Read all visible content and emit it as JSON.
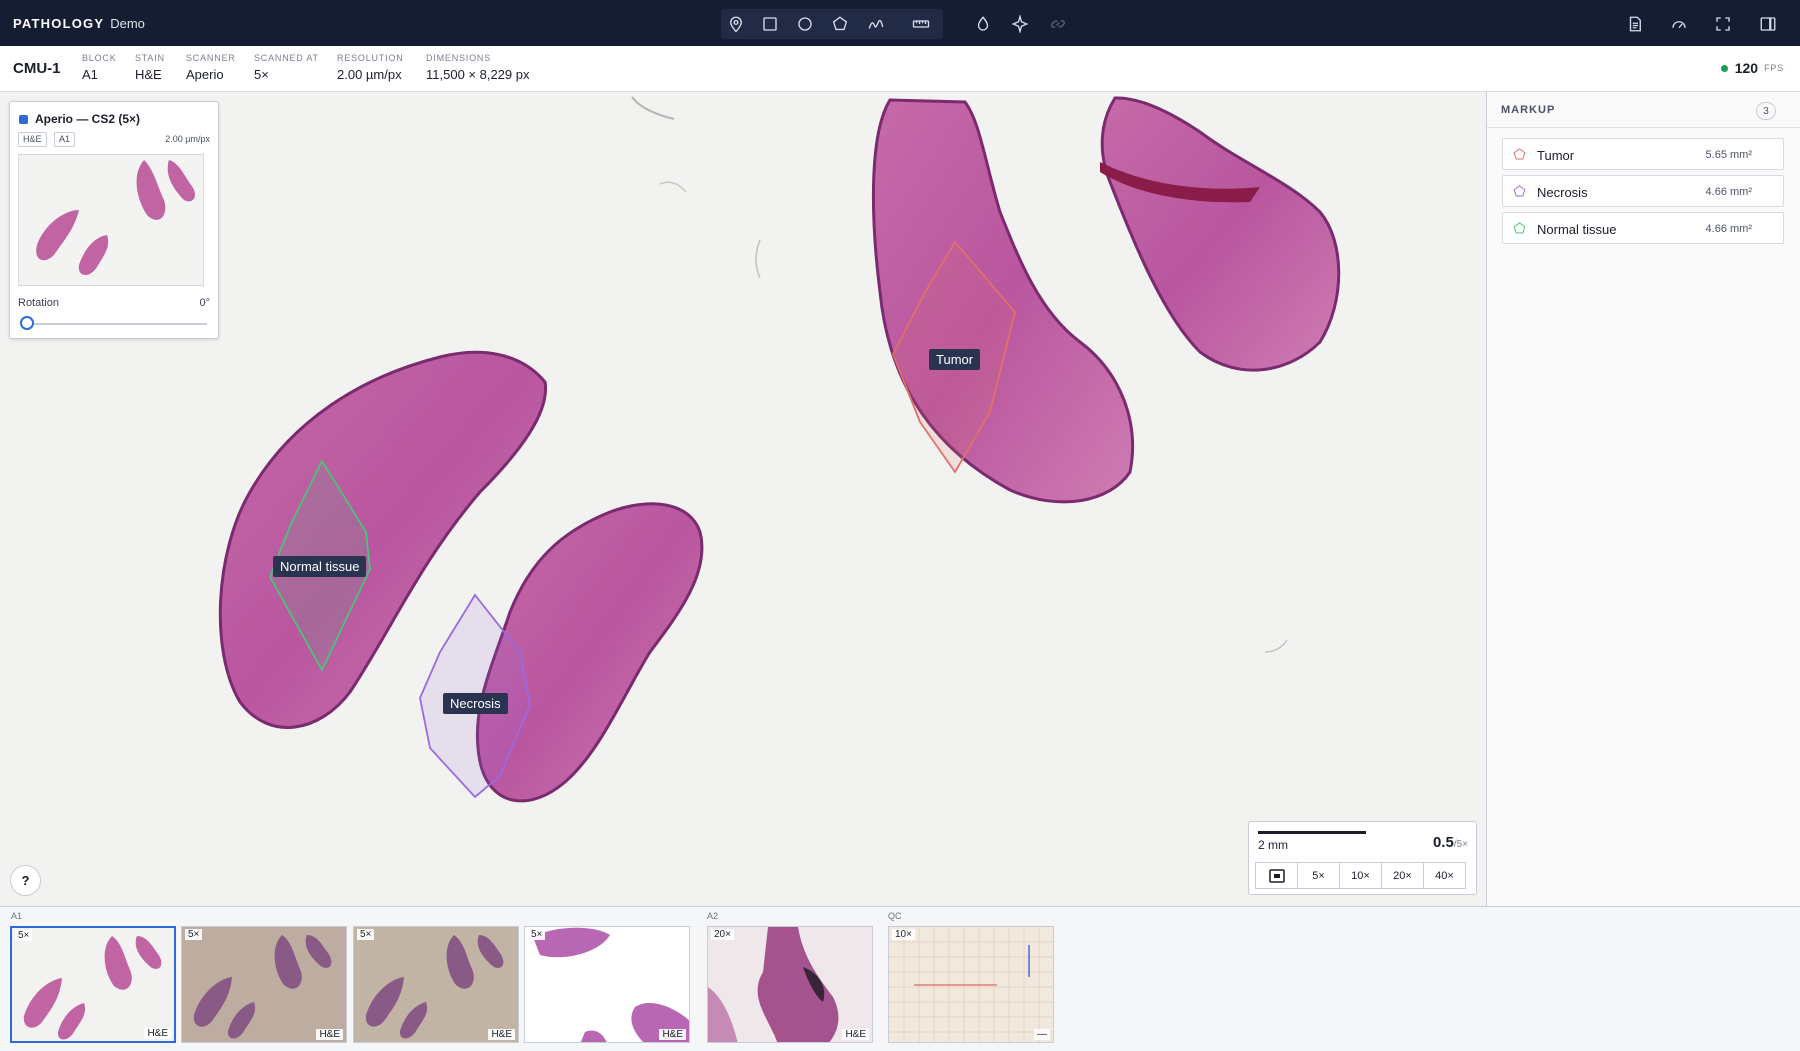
{
  "app": {
    "brand": "PATHOLOGY",
    "brand_sub": "Demo"
  },
  "toolbar": {
    "tools": [
      "pin-tool",
      "rectangle-tool",
      "circle-tool",
      "polygon-tool",
      "freehand-tool",
      "ruler-tool",
      "stain-tool",
      "sparkle-tool",
      "link-tool"
    ],
    "right_tools": [
      "report-icon",
      "speed-icon",
      "fullscreen-icon",
      "panel-toggle-icon"
    ]
  },
  "slide": {
    "id": "CMU-1",
    "fields": [
      {
        "label": "BLOCK",
        "value": "A1"
      },
      {
        "label": "STAIN",
        "value": "H&E"
      },
      {
        "label": "SCANNER",
        "value": "Aperio"
      },
      {
        "label": "SCANNED AT",
        "value": "5×"
      },
      {
        "label": "RESOLUTION",
        "value": "2.00 µm/px"
      },
      {
        "label": "DIMENSIONS",
        "value": "11,500 × 8,229 px"
      }
    ],
    "fps_value": "120",
    "fps_unit": "FPS"
  },
  "overview": {
    "title": "Aperio — CS2 (5×)",
    "chips": [
      "H&E",
      "A1"
    ],
    "resolution": "2.00 µm/px",
    "rotation_label": "Rotation",
    "rotation_value": "0°",
    "rotation": 0
  },
  "annotations": [
    {
      "label": "Tumor",
      "color": "#e0706a"
    },
    {
      "label": "Necrosis",
      "color": "#9a6ae0"
    },
    {
      "label": "Normal tissue",
      "color": "#4cc27a"
    }
  ],
  "help": {
    "label": "?"
  },
  "scale": {
    "bar_label": "2 mm",
    "zoom_value": "0.5",
    "zoom_of": "/5×",
    "buttons": [
      "5×",
      "10×",
      "20×",
      "40×"
    ]
  },
  "markup": {
    "header": "MARKUP",
    "count": "3",
    "items": [
      {
        "name": "Tumor",
        "area": "5.65 mm²",
        "color": "#e0706a"
      },
      {
        "name": "Necrosis",
        "area": "4.66 mm²",
        "color": "#9a6ae0"
      },
      {
        "name": "Normal tissue",
        "area": "4.66 mm²",
        "color": "#4cc27a"
      }
    ]
  },
  "filmstrip": {
    "groups": [
      "A1",
      "A2",
      "QC"
    ],
    "cards": [
      {
        "mag": "5×",
        "stain": "H&E"
      },
      {
        "mag": "5×",
        "stain": "H&E"
      },
      {
        "mag": "5×",
        "stain": "H&E"
      },
      {
        "mag": "5×",
        "stain": "H&E"
      },
      {
        "mag": "20×",
        "stain": "H&E"
      },
      {
        "mag": "10×",
        "stain": "—"
      }
    ]
  }
}
